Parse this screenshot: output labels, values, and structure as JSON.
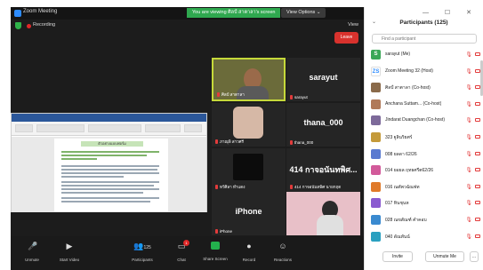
{
  "window": {
    "title": "Zoom Meeting"
  },
  "banner": {
    "sharing_text": "You are viewing ศิลป์ สาตาลา's screen",
    "view_options": "View Options ⌄"
  },
  "infobar": {
    "recording": "Recording",
    "view": "View"
  },
  "shared_doc": {
    "heading": "ตัวอย่างแบบฟอร์ม"
  },
  "tiles": [
    {
      "big": "",
      "name": "ศิลป์ สาตาลา"
    },
    {
      "big": "sarayut",
      "name": "sarayut"
    },
    {
      "big": "",
      "name": "ภาณุพิ สาวศรี"
    },
    {
      "big": "thana_000",
      "name": "thana_000"
    },
    {
      "big": "",
      "name": "ทวีศิลา ทำแดง"
    },
    {
      "big": "414 กาจอนันทพิศ...",
      "name": "414 กาจอนันทพิศ นายกฤต"
    },
    {
      "big": "iPhone",
      "name": "iPhone"
    },
    {
      "big": "",
      "name": ""
    }
  ],
  "toolbar": {
    "unmute": "Unmute",
    "start_video": "Start Video",
    "participants": "Participants",
    "participants_count": "125",
    "chat": "Chat",
    "chat_badge": "1",
    "share_screen": "Share Screen",
    "record": "Record",
    "reactions": "Reactions",
    "leave": "Leave"
  },
  "panel": {
    "title": "Participants (125)",
    "search_placeholder": "Find a participant",
    "invite": "Invite",
    "unmute_me": "Unmute Me",
    "more": "...",
    "participants": [
      {
        "avatar": "S",
        "color": "#3aa757",
        "name": "sarayut (Me)"
      },
      {
        "avatar": "ZS",
        "color": "#ffffff",
        "name": "Zoom Meeting 32 (Host)"
      },
      {
        "avatar": "",
        "color": "#8a6a4a",
        "name": "ศิลป์ สาตาลา (Co-host)"
      },
      {
        "avatar": "",
        "color": "#b07a5a",
        "name": "Anchana Suttam... (Co-host)"
      },
      {
        "avatar": "",
        "color": "#7d6a9a",
        "name": "Jindarat Duangchan (Co-host)"
      },
      {
        "avatar": "",
        "color": "#c49a3a",
        "name": "323 ฐูลินริยศร์"
      },
      {
        "avatar": "",
        "color": "#5a7ad0",
        "name": "008 ยลดา 62/26"
      },
      {
        "avatar": "",
        "color": "#d25a9a",
        "name": "014 ยอยล ฤทธศรีต62/26"
      },
      {
        "avatar": "",
        "color": "#e07a2a",
        "name": "016 ณตัพวฉัณฟท"
      },
      {
        "avatar": "",
        "color": "#8a5ad0",
        "name": "017 ทินชุนห"
      },
      {
        "avatar": "",
        "color": "#3a8ad0",
        "name": "028 ณขสัณฑ์ คำคอบ"
      },
      {
        "avatar": "",
        "color": "#2aa0c0",
        "name": "040 ดัณทันน์"
      }
    ]
  }
}
